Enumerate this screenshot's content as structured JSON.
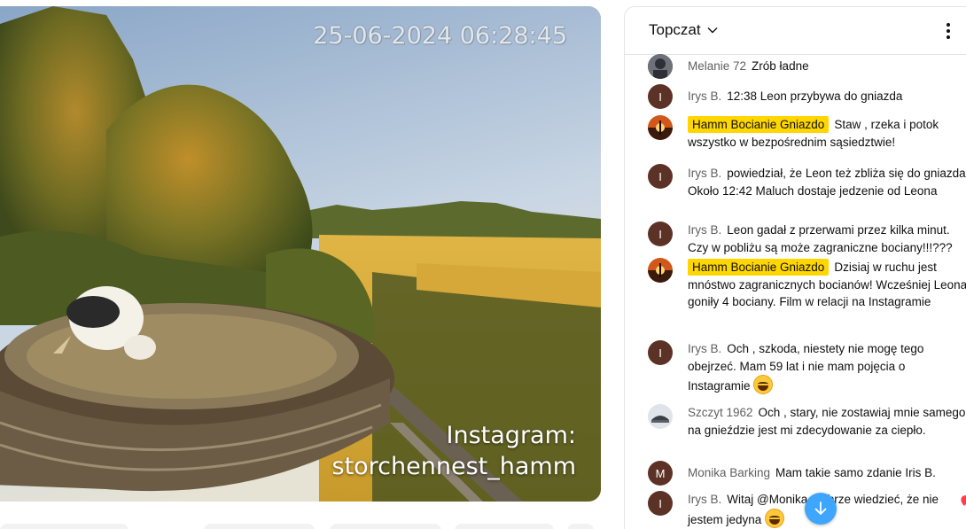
{
  "video": {
    "timestamp": "25-06-2024 06:28:45",
    "overlay_line1": "Instagram:",
    "overlay_line2": "storchennest_hamm"
  },
  "chat": {
    "title": "Topczat",
    "messages": [
      {
        "author": "Melanie 72",
        "text": "Zrób ładne",
        "avatar": "photo",
        "owner": false
      },
      {
        "author": "Irys B.",
        "text": "12:38 Leon przybywa do gniazda",
        "avatar": "I",
        "owner": false
      },
      {
        "author": "Hamm Bocianie Gniazdo",
        "text": "Staw , rzeka i potok wszystko w bezpośrednim sąsiedztwie!",
        "avatar": "sunset",
        "owner": true
      },
      {
        "author": "Irys B.",
        "text": "powiedział, że Leon też zbliża się do gniazda. Około 12:42 Maluch dostaje jedzenie od Leona",
        "avatar": "I",
        "owner": false
      },
      {
        "author": "Irys B.",
        "text": "Leon gadał z przerwami przez kilka minut. Czy w pobliżu są może zagraniczne bociany!!!???",
        "avatar": "I",
        "owner": false
      },
      {
        "author": "Hamm Bocianie Gniazdo",
        "text": "Dzisiaj w ruchu jest mnóstwo zagranicznych bocianów! Wcześniej Leona goniły 4 bociany. Film w relacji na Instagramie",
        "avatar": "sunset",
        "owner": true
      },
      {
        "author": "Irys B.",
        "text": "Och , szkoda, niestety nie mogę tego obejrzeć. Mam 59 lat i nie mam pojęcia o Instagramie",
        "avatar": "I",
        "owner": false,
        "emoji": "sweat-smile"
      },
      {
        "author": "Szczyt 1962",
        "text": "Och , stary, nie zostawiaj mnie samego, na gnieździe jest mi zdecydowanie za ciepło.",
        "avatar": "photo2",
        "owner": false
      },
      {
        "author": "Monika Barking",
        "text": "Mam takie samo zdanie Iris B.",
        "avatar": "M",
        "owner": false
      },
      {
        "author": "Irys B.",
        "text": "Witaj @Monika, dobrze wiedzieć, że nie jestem jedyna",
        "avatar": "I",
        "owner": false,
        "emoji": "sweat-smile"
      }
    ]
  },
  "icons": {
    "menu": "more-vert-icon",
    "chevron": "chevron-down-icon",
    "scroll": "arrow-down-icon"
  },
  "colors": {
    "owner_badge": "#ffd600",
    "avatar_letter_bg": "#5d3226",
    "scroll_button": "#3ea6ff"
  }
}
